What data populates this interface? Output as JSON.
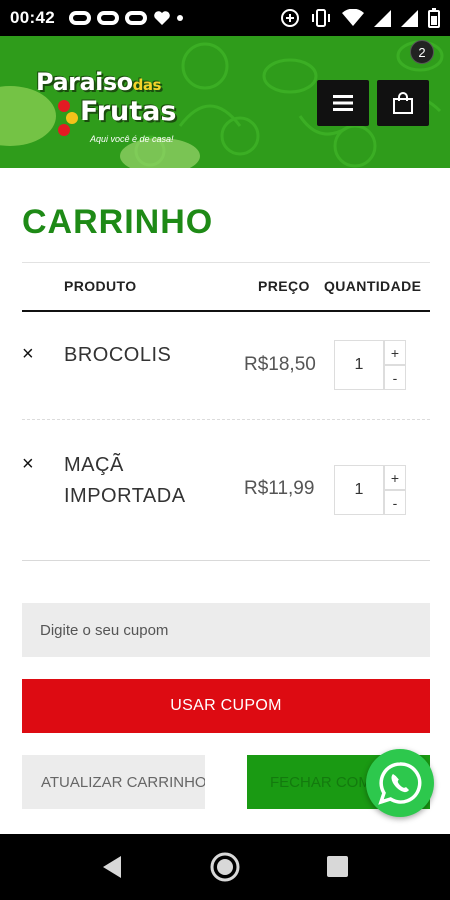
{
  "status_bar": {
    "time": "00:42",
    "notification_icons": [
      "notification-icon",
      "notification-icon",
      "notification-icon",
      "heart-icon"
    ],
    "right_icons": [
      "sync-icon",
      "vibrate-icon",
      "wifi-icon",
      "signal-icon",
      "signal-icon",
      "battery-icon"
    ]
  },
  "header": {
    "logo": {
      "line1": "Paraiso",
      "line1_small": "das",
      "line2": "Frutas",
      "tagline": "Aqui você é de casa!"
    },
    "cart_count": "2"
  },
  "cart": {
    "title": "CARRINHO",
    "columns": {
      "product": "PRODUTO",
      "price": "PREÇO",
      "quantity": "QUANTIDADE"
    },
    "items": [
      {
        "name_line1": "BROCOLIS",
        "name_line2": "",
        "price": "R$18,50",
        "quantity": "1",
        "remove": "×",
        "plus": "+",
        "minus": "-"
      },
      {
        "name_line1": "MAÇÃ",
        "name_line2": "IMPORTADA",
        "price": "R$11,99",
        "quantity": "1",
        "remove": "×",
        "plus": "+",
        "minus": "-"
      }
    ]
  },
  "coupon": {
    "placeholder": "Digite o seu cupom",
    "apply_label": "USAR CUPOM"
  },
  "actions": {
    "update_label": "ATUALIZAR CARRINHO",
    "checkout_label": "FECHAR COMPRA"
  },
  "colors": {
    "brand_green": "#2f9c1b",
    "title_green": "#1e8a16",
    "coupon_red": "#dd0b12",
    "checkout_green": "#1a9a13",
    "whatsapp_green": "#2dc84d"
  }
}
